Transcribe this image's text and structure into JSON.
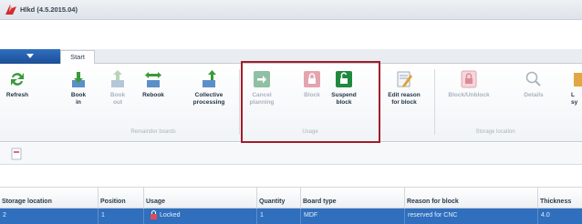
{
  "window": {
    "title": "Hlkd (4.5.2015.04)",
    "icon": "app-logo"
  },
  "ribbon": {
    "tabs": [
      {
        "label": "Start",
        "active": true
      }
    ],
    "groups": [
      {
        "label": "Remainder boards",
        "buttons": [
          {
            "label": "Refresh",
            "icon": "refresh-icon",
            "enabled": true
          },
          {
            "label": "Book in",
            "icon": "book-in-icon",
            "enabled": true
          },
          {
            "label": "Book out",
            "icon": "book-out-icon",
            "enabled": false
          },
          {
            "label": "Rebook",
            "icon": "rebook-icon",
            "enabled": true
          },
          {
            "label": "Collective processing",
            "icon": "collective-processing-icon",
            "enabled": true
          }
        ]
      },
      {
        "label": "Usage",
        "buttons": [
          {
            "label": "Cancel planning",
            "icon": "cancel-planning-icon",
            "enabled": false
          },
          {
            "label": "Block",
            "icon": "block-icon",
            "enabled": false
          },
          {
            "label": "Suspend block",
            "icon": "suspend-block-icon",
            "enabled": true
          },
          {
            "label": "Edit reason for block",
            "icon": "edit-reason-icon",
            "enabled": true
          }
        ]
      },
      {
        "label": "Storage location",
        "buttons": [
          {
            "label": "Block/Unblock",
            "icon": "block-unblock-icon",
            "enabled": false
          },
          {
            "label": "Details",
            "icon": "magnifier-icon",
            "enabled": false
          },
          {
            "label": "L sy",
            "icon": "truncated-icon",
            "enabled": true
          }
        ]
      }
    ],
    "highlight_color": "#a31d2b"
  },
  "grid": {
    "columns": [
      "Storage location",
      "Position",
      "Usage",
      "Quantity",
      "Board type",
      "Reason for block",
      "Thickness"
    ],
    "rows": [
      [
        "2",
        "1",
        "Locked",
        "1",
        "MDF",
        "reserved for CNC",
        "4.0"
      ]
    ],
    "selected_row_color": "#2f6fbd"
  }
}
